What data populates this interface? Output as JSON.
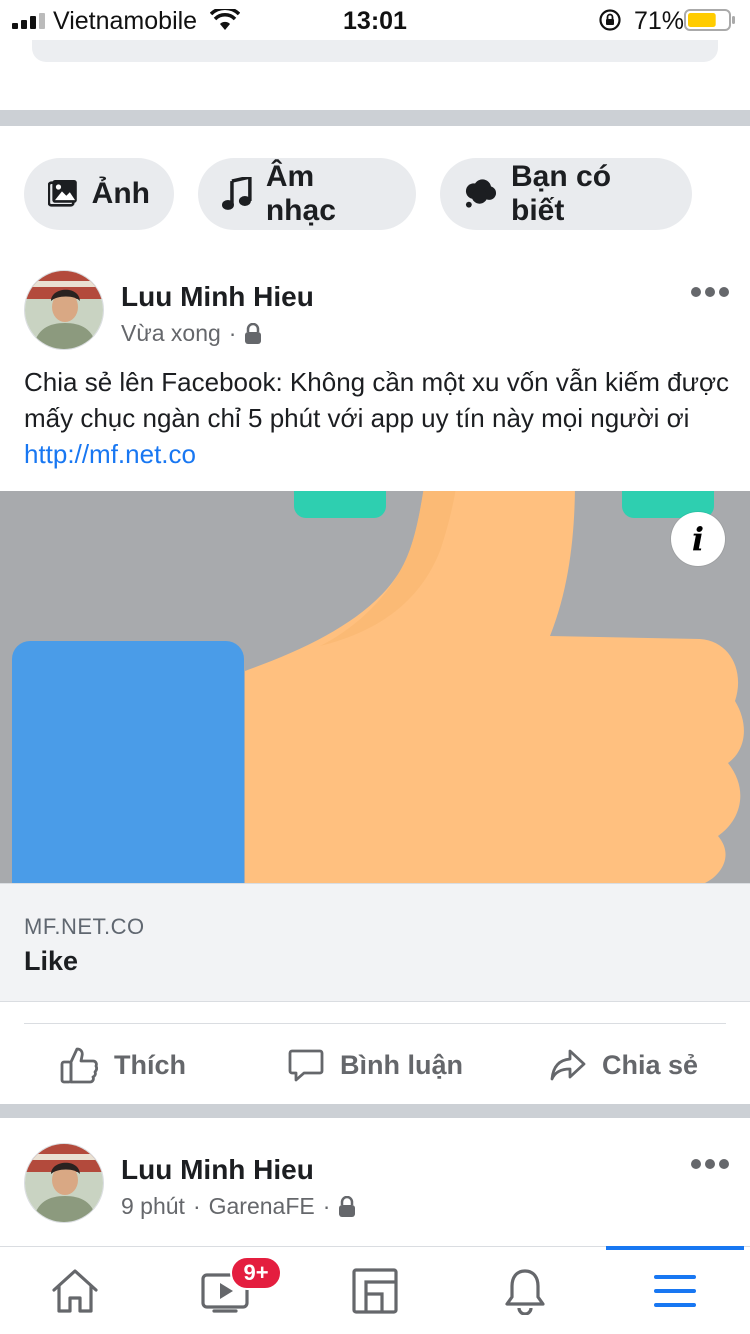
{
  "status_bar": {
    "carrier": "Vietnamobile",
    "time": "13:01",
    "battery_percent": "71%",
    "battery_level": 0.71,
    "battery_color": "#ffcc00"
  },
  "chips": [
    {
      "label": "Ảnh",
      "icon": "photo-icon"
    },
    {
      "label": "Âm nhạc",
      "icon": "music-note-icon"
    },
    {
      "label": "Bạn có biết",
      "icon": "speech-cloud-icon"
    }
  ],
  "post1": {
    "author": "Luu Minh Hieu",
    "time": "Vừa xong",
    "separator": "·",
    "privacy_icon": "lock-icon",
    "text": "Chia sẻ lên Facebook: Không cần một xu vốn vẫn kiếm được mấy chục ngàn chỉ 5 phút với app uy tín này mọi người ơi ",
    "link_text": "http://mf.net.co",
    "link_preview": {
      "domain": "MF.NET.CO",
      "title": "Like",
      "info_icon": "i"
    },
    "actions": {
      "like": "Thích",
      "comment": "Bình luận",
      "share": "Chia sẻ"
    }
  },
  "post2": {
    "author": "Luu Minh Hieu",
    "time": "9 phút",
    "app": "GarenaFE",
    "separator": "·",
    "privacy_icon": "lock-icon"
  },
  "bottom_nav": {
    "items": [
      "home-icon",
      "watch-icon",
      "pages-icon",
      "notifications-icon",
      "menu-icon"
    ],
    "watch_badge": "9+",
    "active": "menu-icon"
  },
  "colors": {
    "accent": "#1877f2",
    "badge": "#e41e3f",
    "image_bg": "#a8aaad",
    "thumb": "#ffc07f",
    "cuff": "#4a9ce8",
    "teal": "#2ecfb0"
  }
}
